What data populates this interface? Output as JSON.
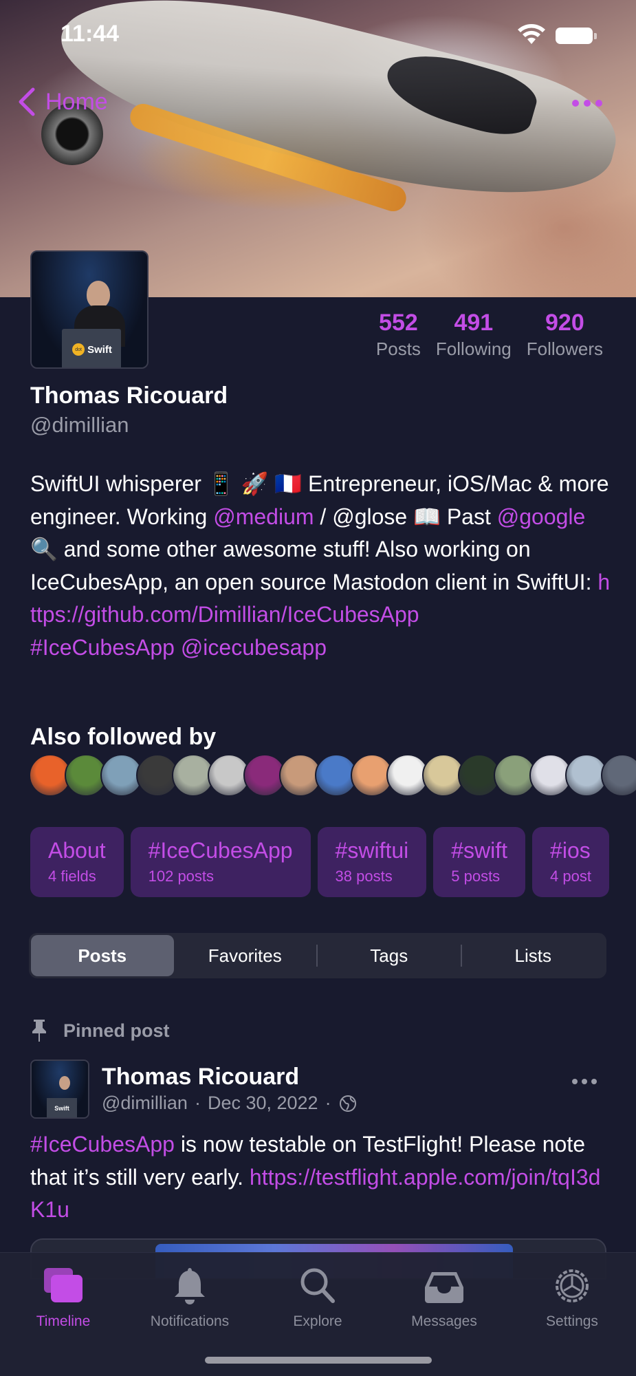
{
  "status_bar": {
    "time": "11:44"
  },
  "nav": {
    "back_label": "Home"
  },
  "profile": {
    "name": "Thomas Ricouard",
    "handle": "@dimillian",
    "avatar_text": "Swift",
    "avatar_badge": "dot",
    "stats": [
      {
        "value": "552",
        "label": "Posts"
      },
      {
        "value": "491",
        "label": "Following"
      },
      {
        "value": "920",
        "label": "Followers"
      }
    ]
  },
  "bio": {
    "seg1": "SwiftUI whisperer 📱 🚀 🇫🇷 Entrepreneur, iOS/Mac & more engineer. Working ",
    "link_medium": "@medium",
    "seg2": " / @glose 📖 Past ",
    "link_google": "@google",
    "seg3": " 🔍 and some other awesome stuff! Also working on IceCubesApp, an open source Mastodon client in SwiftUI: ",
    "link_github": "https://github.com/Dimillian/IceCubesApp",
    "hashtag": "#IceCubesApp",
    "mention": "@icecubesapp"
  },
  "also_followed": {
    "title": "Also followed by",
    "avatar_colors": [
      "#e8622a",
      "#5b8a3a",
      "#7fa0b8",
      "#3a3a3a",
      "#a8b0a0",
      "#c8c8c8",
      "#8a2a7a",
      "#c89a7a",
      "#4a7ac8",
      "#e8a070",
      "#f0f0f0",
      "#d8c89a",
      "#2a3a2a",
      "#8aa07a",
      "#e0e0e8",
      "#b0c0d0",
      "#606878"
    ]
  },
  "chips": [
    {
      "title": "About",
      "sub": "4 fields"
    },
    {
      "title": "#IceCubesApp",
      "sub": "102 posts"
    },
    {
      "title": "#swiftui",
      "sub": "38 posts"
    },
    {
      "title": "#swift",
      "sub": "5 posts"
    },
    {
      "title": "#ios",
      "sub": "4 post"
    }
  ],
  "tabs_segment": [
    "Posts",
    "Favorites",
    "Tags",
    "Lists"
  ],
  "pinned": {
    "label": "Pinned post",
    "author": "Thomas Ricouard",
    "handle": "@dimillian",
    "date": "Dec 30, 2022",
    "separator": "·",
    "body_hashtag": "#IceCubesApp",
    "body_text": " is now testable on TestFlight! Please note that it’s still very early. ",
    "body_link": "https://testflight.apple.com/join/tqI3dK1u"
  },
  "tab_bar": [
    {
      "label": "Timeline",
      "icon": "timeline-icon",
      "active": true
    },
    {
      "label": "Notifications",
      "icon": "bell-icon",
      "active": false
    },
    {
      "label": "Explore",
      "icon": "search-icon",
      "active": false
    },
    {
      "label": "Messages",
      "icon": "tray-icon",
      "active": false
    },
    {
      "label": "Settings",
      "icon": "gear-icon",
      "active": false
    }
  ],
  "colors": {
    "accent": "#c34de6",
    "background": "#181a2e",
    "chip_bg": "#3e2261",
    "secondary_text": "#9a9ca8"
  }
}
